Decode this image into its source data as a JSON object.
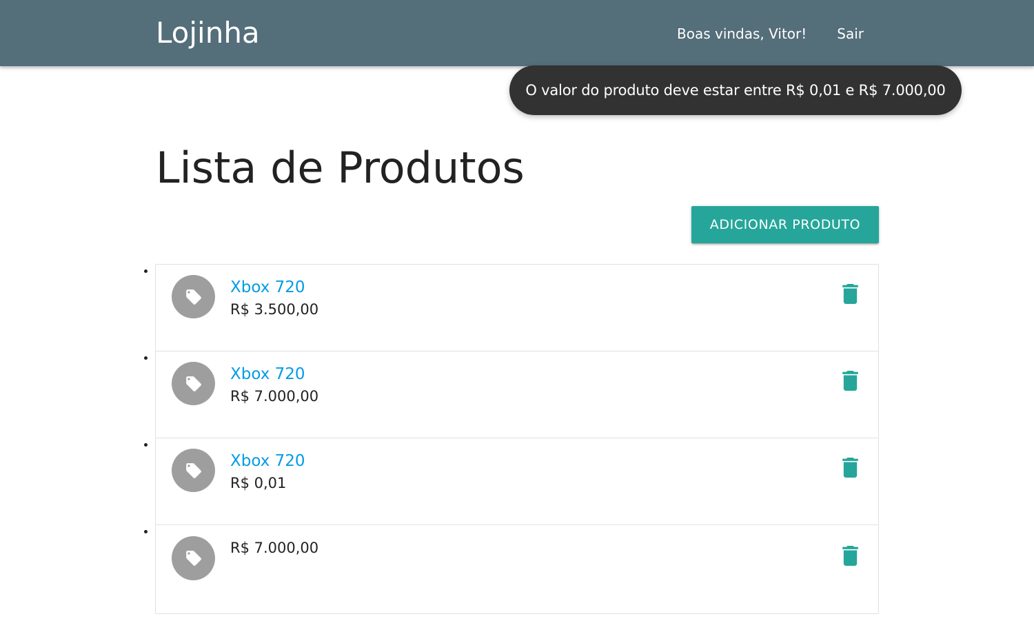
{
  "navbar": {
    "brand": "Lojinha",
    "welcome": "Boas vindas, Vitor!",
    "logout": "Sair",
    "background": "#546e7a"
  },
  "toast": {
    "message": "O valor do produto deve estar entre R$ 0,01 e R$ 7.000,00"
  },
  "main": {
    "title": "Lista de Produtos",
    "add_button_label": "ADICIONAR PRODUTO",
    "accent": "#26a69a",
    "link_color": "#039be5"
  },
  "products": [
    {
      "name": "Xbox 720",
      "price": "R$ 3.500,00",
      "icon": "tag-icon",
      "action_icon": "trash-icon"
    },
    {
      "name": "Xbox 720",
      "price": "R$ 7.000,00",
      "icon": "tag-icon",
      "action_icon": "trash-icon"
    },
    {
      "name": "Xbox 720",
      "price": "R$ 0,01",
      "icon": "tag-icon",
      "action_icon": "trash-icon"
    },
    {
      "name": "",
      "price": "R$ 7.000,00",
      "icon": "tag-icon",
      "action_icon": "trash-icon"
    }
  ]
}
